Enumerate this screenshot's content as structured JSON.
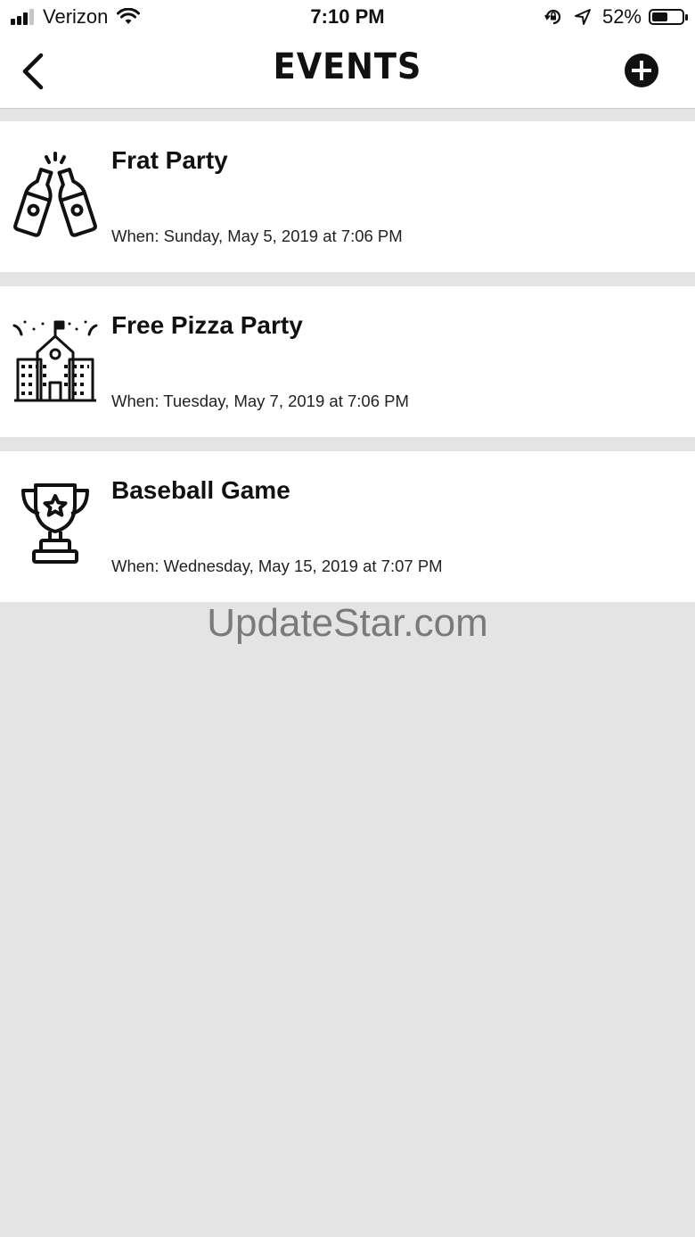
{
  "status_bar": {
    "carrier": "Verizon",
    "time": "7:10 PM",
    "battery_percent_text": "52%",
    "battery_level": 0.52
  },
  "nav": {
    "title": "EVENTS"
  },
  "events": [
    {
      "title": "Frat Party",
      "when": "When: Sunday, May 5, 2019 at 7:06 PM",
      "icon": "beer-bottles-icon"
    },
    {
      "title": "Free Pizza Party",
      "when": "When: Tuesday, May 7, 2019 at 7:06 PM",
      "icon": "school-building-icon"
    },
    {
      "title": "Baseball Game",
      "when": "When: Wednesday, May 15, 2019 at 7:07 PM",
      "icon": "trophy-icon"
    }
  ],
  "watermark": "UpdateStar.com"
}
